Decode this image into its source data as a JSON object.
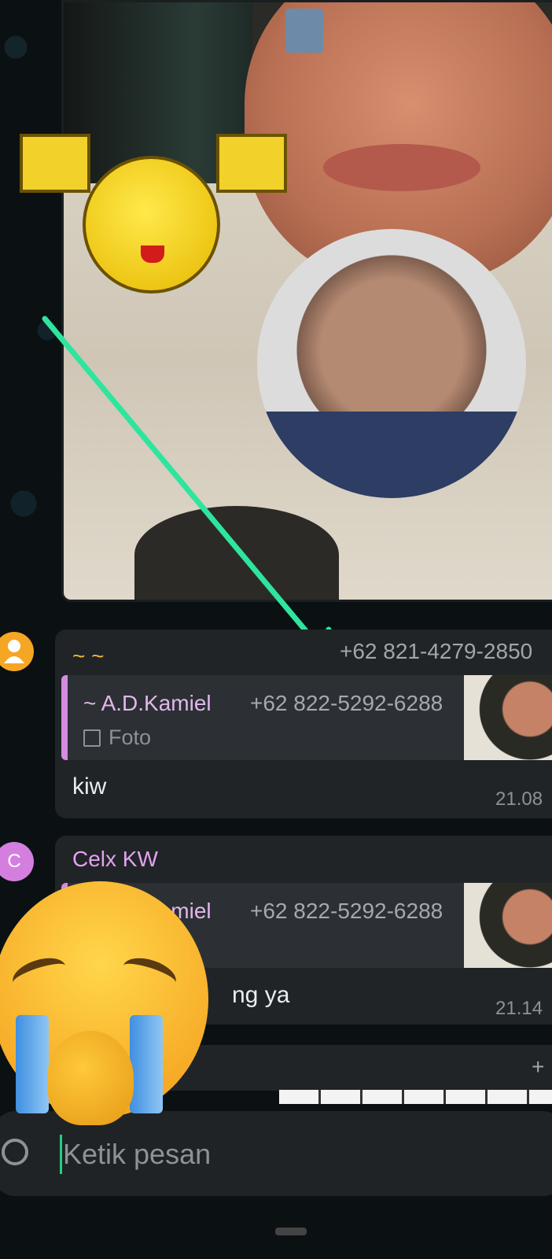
{
  "messages": [
    {
      "sender_name": "~ ~",
      "sender_phone": "+62 821-4279-2850",
      "avatar_color": "#f5a623",
      "quote": {
        "name": "~ A.D.Kamiel",
        "phone": "+62 822-5292-6288",
        "type": "Foto"
      },
      "text": "kiw",
      "time": "21.08"
    },
    {
      "sender_name": "Celx KW",
      "avatar_letter": "C",
      "avatar_color": "#d47fe0",
      "quote": {
        "name": "~ A.D.Kamiel",
        "phone": "+62 822-5292-6288"
      },
      "text": "ng ya",
      "time": "21.14"
    },
    {
      "sender_phone_partial": "+"
    }
  ],
  "input": {
    "placeholder": "Ketik pesan"
  },
  "colors": {
    "accent": "#1fd17b",
    "bubble": "#202427",
    "quote_bar": "#d48be0",
    "arrow": "#2ee59d"
  }
}
